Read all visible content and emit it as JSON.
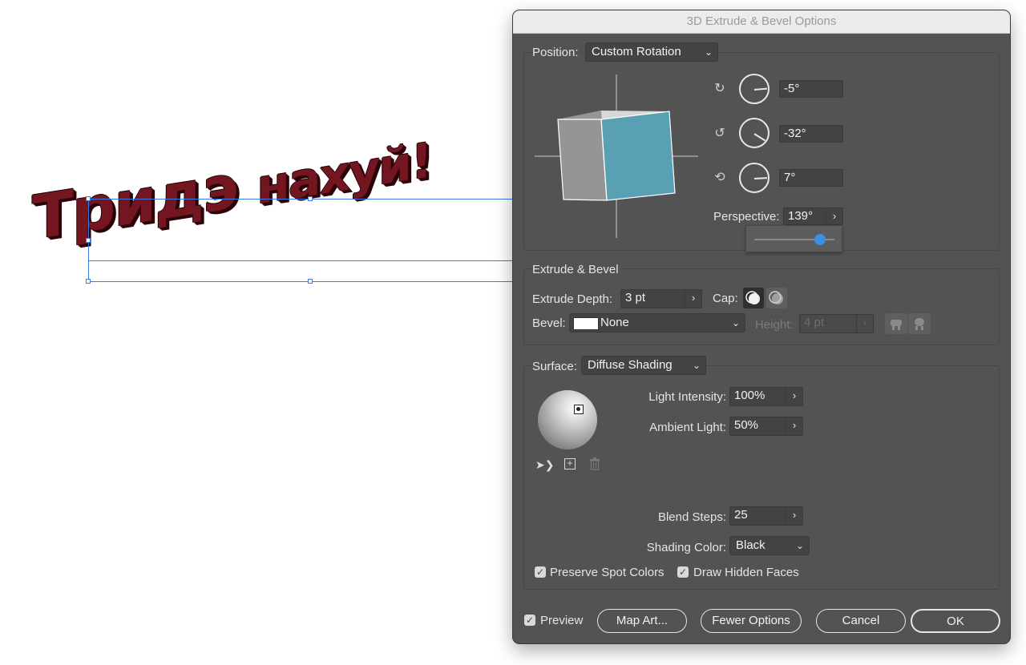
{
  "artwork": {
    "text_main": "Тридэ",
    "text_small": "нахуй!",
    "color": "#74161f"
  },
  "dialog": {
    "title": "3D Extrude & Bevel Options",
    "position": {
      "label": "Position:",
      "value": "Custom Rotation",
      "x_rotation": "-5°",
      "y_rotation": "-32°",
      "z_rotation": "7°",
      "perspective_label": "Perspective:",
      "perspective_value": "139°",
      "perspective_slider": 0.82
    },
    "extrude_bevel": {
      "section_title": "Extrude & Bevel",
      "depth_label": "Extrude Depth:",
      "depth_value": "3 pt",
      "cap_label": "Cap:",
      "bevel_label": "Bevel:",
      "bevel_value": "None",
      "height_label": "Height:",
      "height_value": "4 pt"
    },
    "surface": {
      "label": "Surface:",
      "value": "Diffuse Shading",
      "light_intensity_label": "Light Intensity:",
      "light_intensity_value": "100%",
      "ambient_light_label": "Ambient Light:",
      "ambient_light_value": "50%",
      "blend_steps_label": "Blend Steps:",
      "blend_steps_value": "25",
      "shading_color_label": "Shading Color:",
      "shading_color_value": "Black",
      "preserve_spot_label": "Preserve Spot Colors",
      "draw_hidden_label": "Draw Hidden Faces"
    },
    "footer": {
      "preview_label": "Preview",
      "map_art_label": "Map Art...",
      "fewer_options_label": "Fewer Options",
      "cancel_label": "Cancel",
      "ok_label": "OK"
    },
    "colors": {
      "panel": "#535353",
      "cube_front": "#5aa0b4",
      "cube_side": "#959595",
      "slider_thumb": "#3b8fe8"
    },
    "icons": [
      "x-axis-rotate-icon",
      "y-axis-rotate-icon",
      "z-axis-rotate-icon",
      "move-light-back-icon",
      "new-light-icon",
      "delete-light-icon"
    ]
  }
}
